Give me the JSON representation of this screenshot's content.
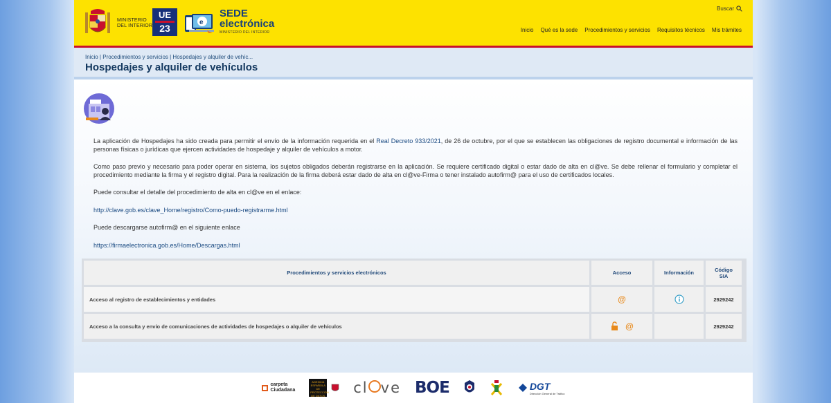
{
  "header": {
    "ministerio": "MINISTERIO\nDEL INTERIOR",
    "ue_top": "UE",
    "ue_bottom": "23",
    "sede_line1": "SEDE",
    "sede_line2": "electrónica",
    "sede_line3": "MINISTERIO DEL INTERIOR",
    "search_label": "Buscar",
    "nav": [
      {
        "label": "Inicio"
      },
      {
        "label": "Qué es la sede"
      },
      {
        "label": "Procedimientos y servicios"
      },
      {
        "label": "Requisitos técnicos"
      },
      {
        "label": "Mis trámites"
      }
    ]
  },
  "breadcrumb": "Inicio | Procedimientos y servicios | Hospedajes y alquiler de vehíc...",
  "page_title": "Hospedajes y alquiler de vehículos",
  "content": {
    "p1_a": "La aplicación de Hospedajes ha sido creada para permitir el envío de la información requerida en el ",
    "p1_link": "Real Decreto 933/2021",
    "p1_b": ", de 26 de octubre, por el que se establecen las obligaciones de registro documental e información de las personas físicas o jurídicas que ejercen actividades de hospedaje y alquiler de vehículos a motor.",
    "p2": "Como paso previo y necesario para poder operar en sistema, los sujetos obligados deberán registrarse en la aplicación. Se requiere certificado digital o estar dado de alta en cl@ve. Se debe rellenar el formulario y completar el procedimiento mediante la firma y el registro digital. Para la realización de la firma deberá estar dado de alta en cl@ve-Firma o tener instalado autofirm@ para el uso de certificados locales.",
    "p3": "Puede consultar el detalle del procedimiento de alta en cl@ve en el enlace:",
    "link1": "http://clave.gob.es/clave_Home/registro/Como-puedo-registrarme.html",
    "p4": "Puede descargarse autofirm@ en el siguiente enlace",
    "link2": "https://firmaelectronica.gob.es/Home/Descargas.html"
  },
  "table": {
    "headers": [
      "Procedimientos y servicios electrónicos",
      "Acceso",
      "Información",
      "Código SIA"
    ],
    "rows": [
      {
        "name": "Acceso al registro de establecimientos y entidades",
        "access": "@",
        "code": "2929242"
      },
      {
        "name": "Acceso a la consulta y envío de comunicaciones de actividades de hospedajes o alquiler de vehículos",
        "access": "@",
        "code": "2929242"
      }
    ]
  },
  "footer": {
    "carpeta_1": "carpeta",
    "carpeta_2": "Ciudadana",
    "aepd": "AGENCIA ESPAÑOLA DE PROTECCIÓN DE DATOS",
    "clave_a": "cl",
    "clave_b": "ve",
    "boe": "BOE",
    "dgt": "DGT",
    "dgt_sub": "Dirección General de Tráfico"
  },
  "colors": {
    "header_yellow": "#fde200",
    "accent_red": "#c8102e",
    "title_blue": "#13385f",
    "access_orange": "#e8891a"
  }
}
